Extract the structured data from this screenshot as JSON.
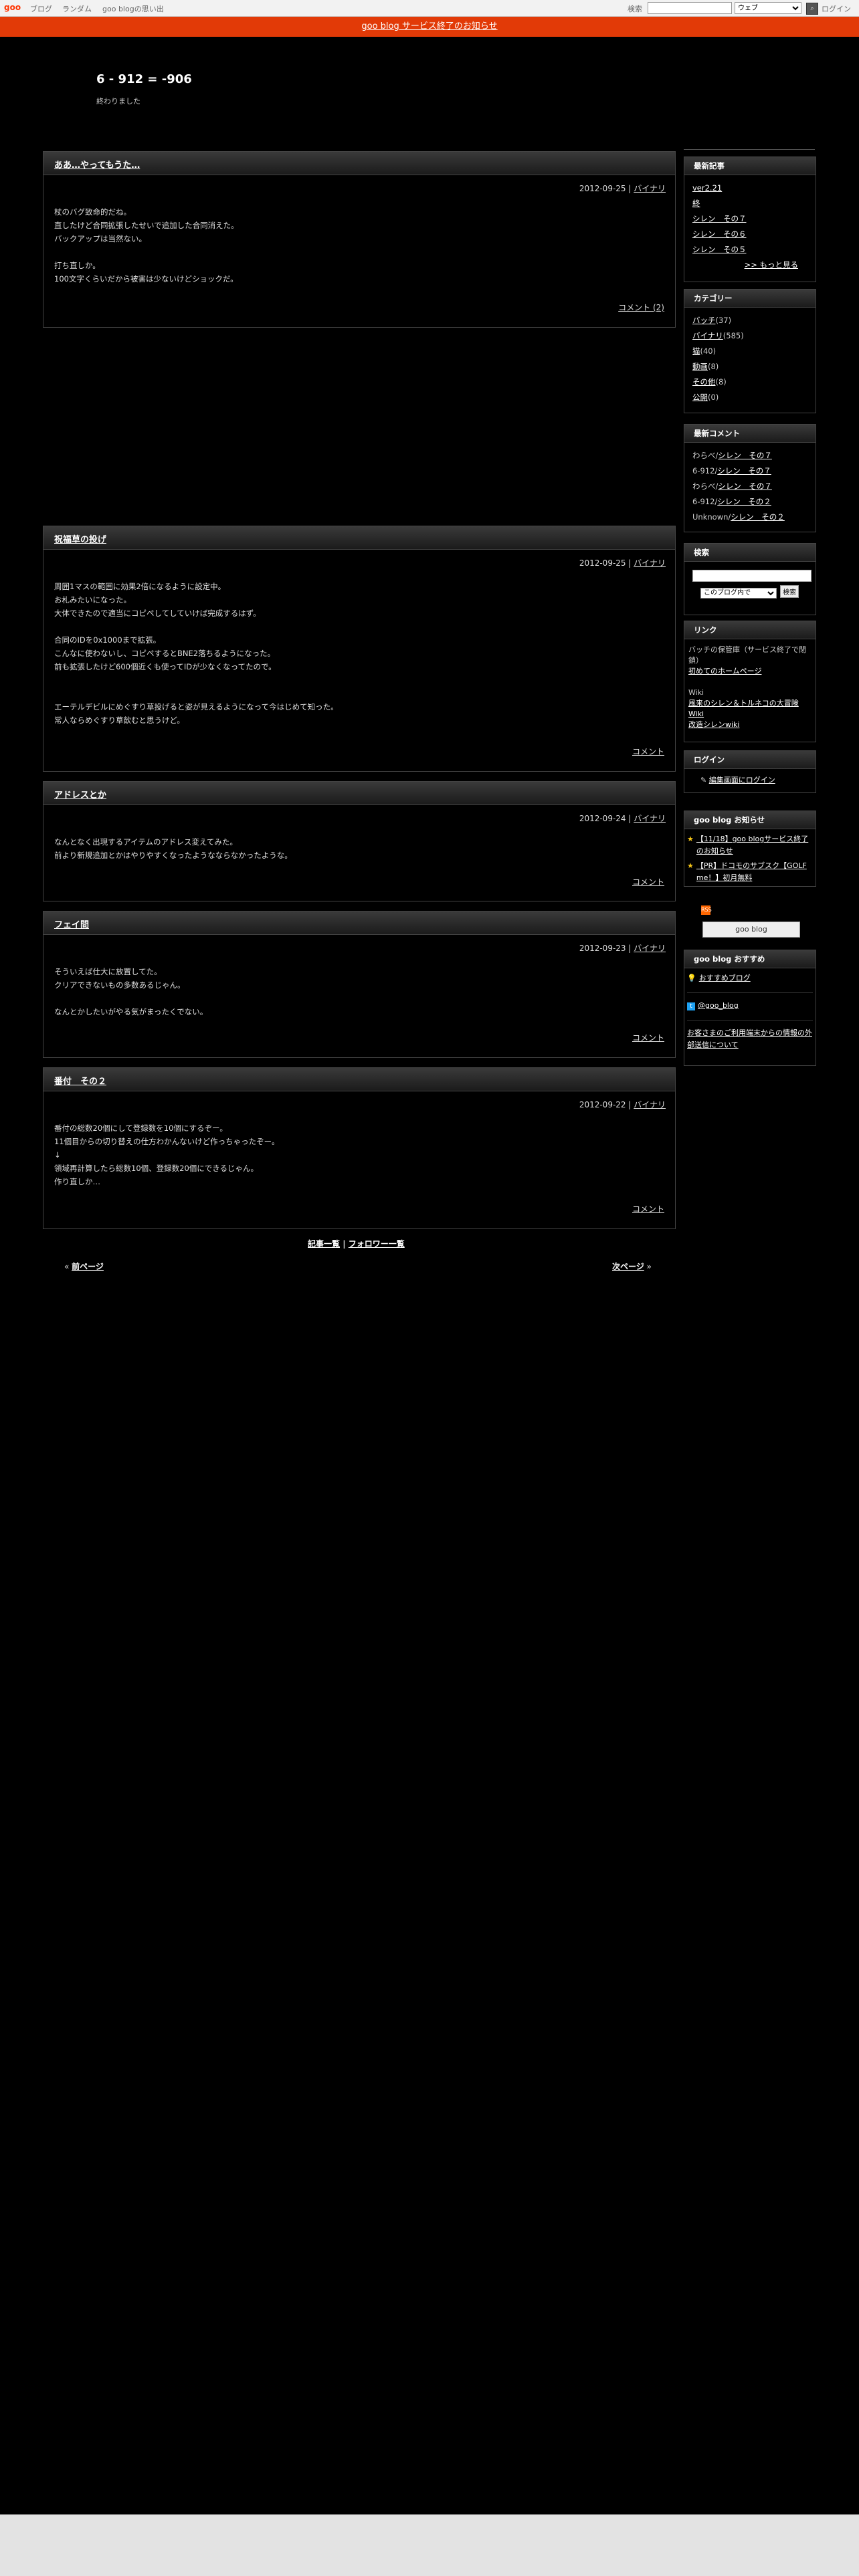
{
  "topbar": {
    "logo": "goo",
    "nav": [
      "ブログ",
      "ランダム",
      "goo blogの思い出"
    ],
    "search_label": "検索",
    "search_value": "",
    "search_scope": "ウェブ",
    "login": "ログイン"
  },
  "notice": "goo blog サービス終了のお知らせ",
  "header": {
    "title": "6 - 912 = -906",
    "description": "終わりました"
  },
  "entries": [
    {
      "title": "ああ…やってもうた…",
      "date": "2012-09-25",
      "category": "バイナリ",
      "lines": [
        "杖のバグ致命的だね。",
        "直したけど合同拡張したせいで追加した合同消えた。",
        "バックアップは当然ない。",
        "",
        "打ち直しか。",
        "100文字くらいだから被害は少ないけどショックだ。"
      ],
      "footer": "コメント (2)"
    },
    {
      "title": "祝福草の投げ",
      "date": "2012-09-25",
      "category": "バイナリ",
      "lines": [
        "周囲1マスの範囲に効果2倍になるように設定中。",
        "お札みたいになった。",
        "大体できたので適当にコピペしてしていけば完成するはず。",
        "",
        "合同のIDを0x1000まで拡張。",
        "こんなに使わないし、コピペするとBNE2落ちるようになった。",
        "前も拡張したけど600個近くも使ってIDが少なくなってたので。",
        "",
        "",
        "エーテルデビルにめぐすり草投げると姿が見えるようになって今はじめて知った。",
        "常人ならめぐすり草飲むと思うけど。"
      ],
      "footer": "コメント"
    },
    {
      "title": "アドレスとか",
      "date": "2012-09-24",
      "category": "バイナリ",
      "lines": [
        "なんとなく出現するアイテムのアドレス変えてみた。",
        "前より新規追加とかはやりやすくなったようなならなかったような。"
      ],
      "footer": "コメント"
    },
    {
      "title": "フェイ問",
      "date": "2012-09-23",
      "category": "バイナリ",
      "lines": [
        "そういえば仕大に放置してた。",
        "クリアできないもの多数あるじゃん。",
        "",
        "なんとかしたいがやる気がまったくでない。"
      ],
      "footer": "コメント"
    },
    {
      "title": "番付　その２",
      "date": "2012-09-22",
      "category": "バイナリ",
      "lines": [
        "番付の総数20個にして登録数を10個にするぞー。",
        "11個目からの切り替えの仕方わかんないけど作っちゃったぞー。",
        "↓",
        "領域再計算したら総数10個、登録数20個にできるじゃん。",
        "作り直しか…"
      ],
      "footer": "コメント"
    }
  ],
  "bottom_links": {
    "list": "記事一覧",
    "sep": "|",
    "followers": "フォロワー一覧"
  },
  "pager": {
    "prev": "前ページ",
    "next": "次ページ"
  },
  "sidebar": {
    "recent": {
      "title": "最新記事",
      "items": [
        "ver2.21",
        "終",
        "シレン　その７",
        "シレン　その６",
        "シレン　その５"
      ],
      "more": ">> もっと見る"
    },
    "categories": {
      "title": "カテゴリー",
      "items": [
        {
          "name": "バッチ",
          "count": "(37)"
        },
        {
          "name": "バイナリ",
          "count": "(585)"
        },
        {
          "name": "猫",
          "count": "(40)"
        },
        {
          "name": "動画",
          "count": "(8)"
        },
        {
          "name": "その他",
          "count": "(8)"
        },
        {
          "name": "公開",
          "count": "(0)"
        }
      ]
    },
    "comments": {
      "title": "最新コメント",
      "items": [
        {
          "who": "わらべ",
          "post": "シレン　その７"
        },
        {
          "who": "6-912",
          "post": "シレン　その７"
        },
        {
          "who": "わらべ",
          "post": "シレン　その７"
        },
        {
          "who": "6-912",
          "post": "シレン　その２"
        },
        {
          "who": "Unknown",
          "post": "シレン　その２"
        }
      ]
    },
    "search": {
      "title": "検索",
      "scope": "このブログ内で",
      "button": "検索"
    },
    "links": {
      "title": "リンク",
      "group1_label": "バッチの保管庫（サービス終了で閉鎖）",
      "group1_link": "初めてのホームページ",
      "group2_label": "Wiki",
      "group2_links": [
        "風来のシレン＆トルネコの大冒険 Wiki",
        "改造シレンwiki"
      ]
    },
    "login": {
      "title": "ログイン",
      "link": "編集画面にログイン"
    },
    "news": {
      "title": "goo blog お知らせ",
      "items": [
        "【11/18】goo blogサービス終了のお知らせ",
        "【PR】ドコモのサブスク【GOLF me！】初月無料"
      ]
    },
    "rss": "RSS",
    "goo_badge": "goo blog",
    "recommend": {
      "title": "goo blog おすすめ",
      "link": "おすすめブログ",
      "twitter": "@goo_blog",
      "notice": "お客さまのご利用端末からの情報の外部送信について"
    }
  }
}
